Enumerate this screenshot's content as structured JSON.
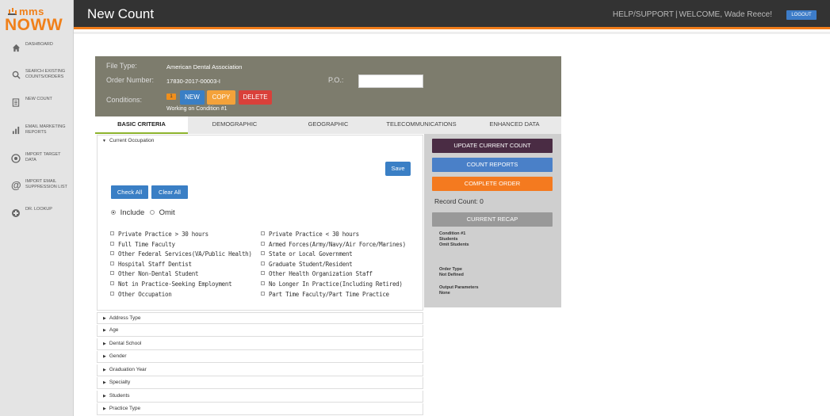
{
  "app": {
    "logo_top": "mms",
    "logo_bottom": "NOWW"
  },
  "sidebar": {
    "items": [
      {
        "label": "DASHBOARD",
        "icon": "home-icon"
      },
      {
        "label": "SEARCH EXISTING COUNTS/ORDERS",
        "icon": "search-icon"
      },
      {
        "label": "NEW COUNT",
        "icon": "document-icon"
      },
      {
        "label": "EMAIL MARKETING REPORTS",
        "icon": "bar-chart-icon"
      },
      {
        "label": "IMPORT TARGET DATA",
        "icon": "target-icon"
      },
      {
        "label": "IMPORT EMAIL SUPPRESSION LIST",
        "icon": "at-icon"
      },
      {
        "label": "DR. LOOKUP",
        "icon": "circle-plus-icon"
      }
    ]
  },
  "header": {
    "title": "New Count",
    "help": "HELP/SUPPORT",
    "welcome": "WELCOME, Wade Reece!",
    "logout": "LOGOUT"
  },
  "order": {
    "file_type_label": "File Type:",
    "file_type_value": "American Dental Association",
    "order_number_label": "Order Number:",
    "order_number_value": "17830-2017-00003-I",
    "po_label": "P.O.:",
    "po_value": "",
    "conditions_label": "Conditions:",
    "condition_badge": "1",
    "btn_new": "NEW",
    "btn_copy": "COPY",
    "btn_delete": "DELETE",
    "working_on": "Working on Condition #1"
  },
  "tabs": [
    "BASIC CRITERIA",
    "DEMOGRAPHIC",
    "GEOGRAPHIC",
    "TELECOMMUNICATIONS",
    "ENHANCED DATA"
  ],
  "criteria": {
    "section_title": "Current Occupation",
    "save": "Save",
    "check_all": "Check All",
    "clear_all": "Clear All",
    "include": "Include",
    "omit": "Omit",
    "left_options": [
      "Private Practice > 30 hours",
      "Full Time Faculty",
      "Other Federal Services(VA/Public Health)",
      "Hospital Staff Dentist",
      "Other Non-Dental Student",
      "Not in Practice-Seeking Employment",
      "Other Occupation"
    ],
    "right_options": [
      "Private Practice < 30 hours",
      "Armed Forces(Army/Navy/Air Force/Marines)",
      "State or Local Government",
      "Graduate Student/Resident",
      "Other Health Organization Staff",
      "No Longer In Practice(Including Retired)",
      "Part Time Faculty/Part Time Practice"
    ]
  },
  "accordion": [
    "Address Type",
    "Age",
    "Dental School",
    "Gender",
    "Graduation Year",
    "Specialty",
    "Students",
    "Practice Type"
  ],
  "actions": {
    "update": "UPDATE CURRENT COUNT",
    "reports": "COUNT REPORTS",
    "complete": "COMPLETE ORDER",
    "record_count": "Record Count: 0",
    "recap": "CURRENT RECAP"
  },
  "recap": {
    "condition": "Condition #1",
    "students": "Students",
    "omit_students": "Omit Students",
    "order_type_label": "Order Type",
    "order_type_value": "Not Defined",
    "output_label": "Output Parameters",
    "output_value": "None"
  },
  "colors": {
    "accent_orange": "#f07c1a",
    "header_bar": "#333333",
    "order_panel": "#7d7c6d",
    "btn_blue": "#3a7fc5",
    "btn_update": "#4a2c44",
    "btn_reports": "#4a80c8",
    "btn_complete": "#f47a1f",
    "btn_recap": "#999999",
    "tab_active": "#8db32d"
  }
}
